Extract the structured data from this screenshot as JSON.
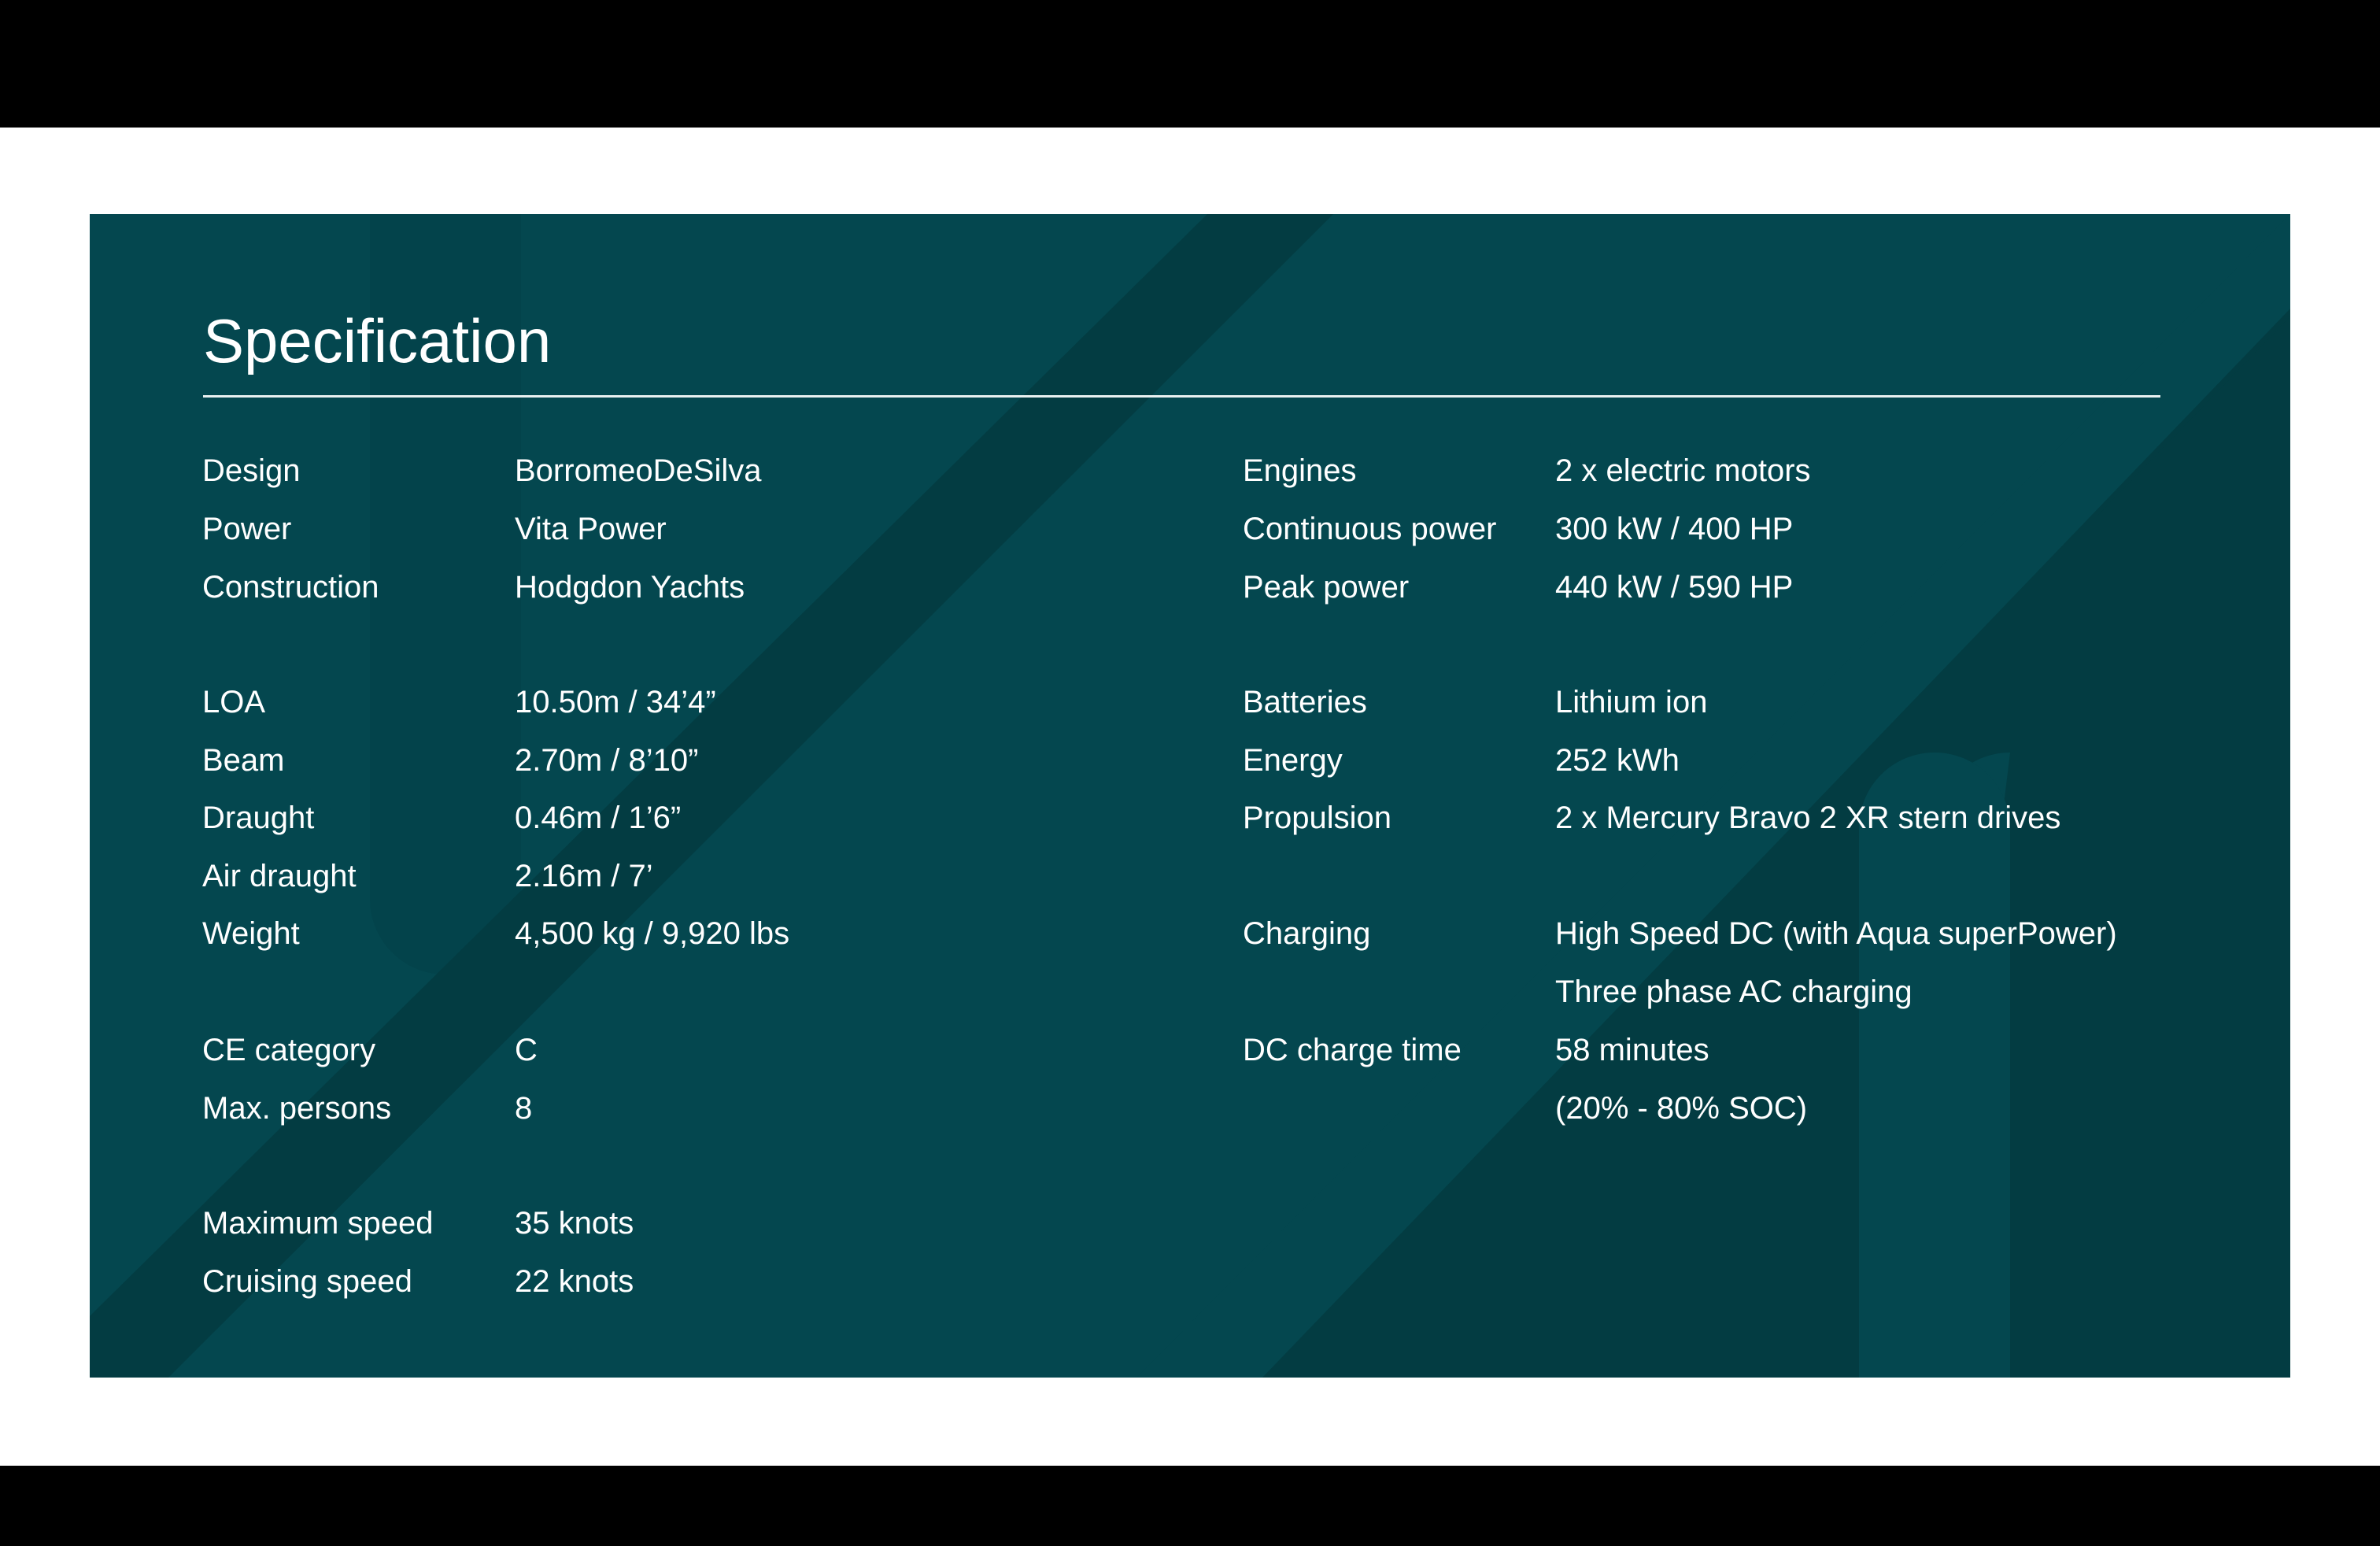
{
  "title": "Specification",
  "colors": {
    "panel": "#04474f",
    "stripe": "#033c42",
    "text": "#ffffff",
    "page": "#ffffff",
    "letterbox": "#000000"
  },
  "left": {
    "design_label": "Design",
    "design_value": "BorromeoDeSilva",
    "power_label": "Power",
    "power_value": "Vita Power",
    "construction_label": "Construction",
    "construction_value": "Hodgdon Yachts",
    "loa_label": "LOA",
    "loa_value": "10.50m / 34’4”",
    "beam_label": "Beam",
    "beam_value": "2.70m  /  8’10”",
    "draught_label": "Draught",
    "draught_value": "0.46m  / 1’6”",
    "air_draught_label": "Air draught",
    "air_draught_value": "2.16m / 7’",
    "weight_label": "Weight",
    "weight_value": "4,500 kg / 9,920 lbs",
    "ce_label": "CE category",
    "ce_value": "C",
    "persons_label": "Max. persons",
    "persons_value": "8",
    "max_speed_label": "Maximum speed",
    "max_speed_value": "35 knots",
    "cruise_speed_label": "Cruising speed",
    "cruise_speed_value": "22 knots"
  },
  "right": {
    "engines_label": "Engines",
    "engines_value": "2 x electric motors",
    "cont_power_label": "Continuous power",
    "cont_power_value": "300 kW / 400 HP",
    "peak_power_label": "Peak power",
    "peak_power_value": "440 kW / 590 HP",
    "batteries_label": "Batteries",
    "batteries_value": "Lithium ion",
    "energy_label": "Energy",
    "energy_value": "252 kWh",
    "propulsion_label": "Propulsion",
    "propulsion_value": "2 x Mercury Bravo 2 XR stern drives",
    "charging_label": "Charging",
    "charging_value_1": "High Speed DC (with Aqua superPower)",
    "charging_value_2": "Three phase AC charging",
    "dc_time_label": "DC charge time",
    "dc_time_value_1": "58 minutes",
    "dc_time_value_2": "(20% - 80% SOC)"
  }
}
